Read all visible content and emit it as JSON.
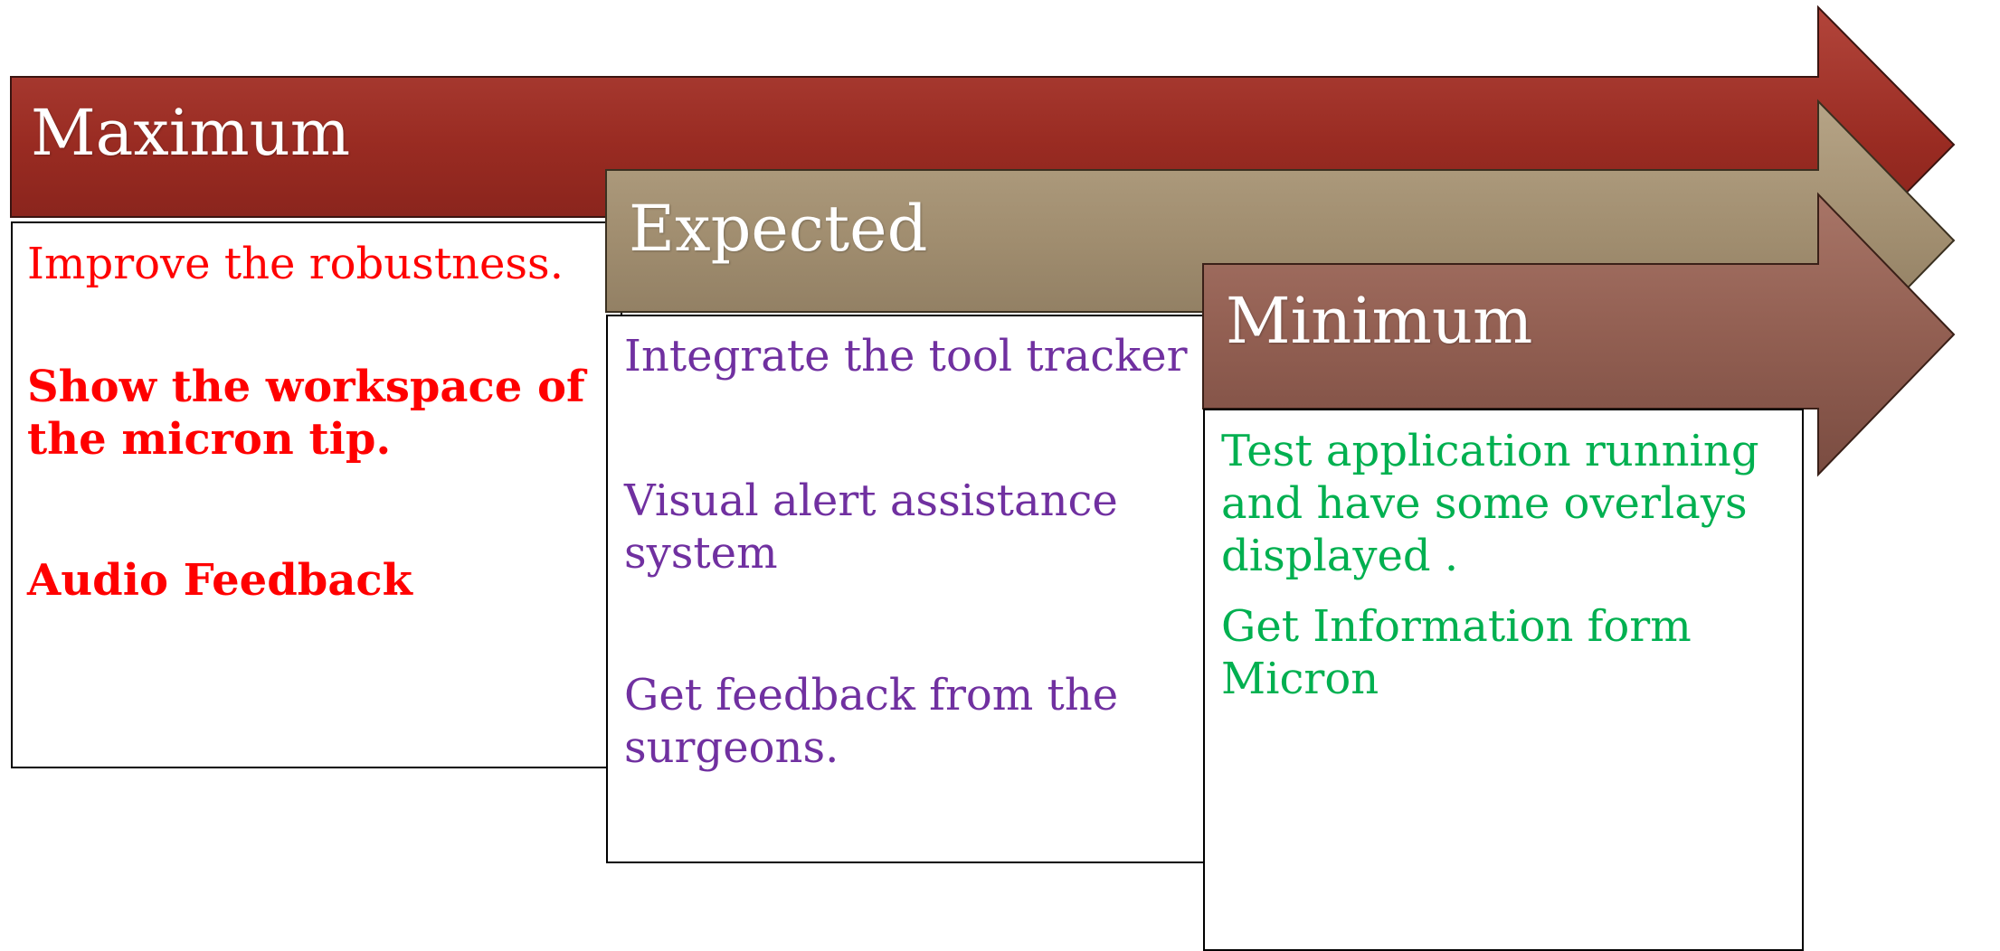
{
  "colors": {
    "maximum_arrow": "#992b22",
    "expected_arrow": "#a08d6f",
    "minimum_arrow": "#925f52",
    "maximum_text": "#ff0000",
    "expected_text": "#7030a0",
    "minimum_text": "#00b050"
  },
  "maximum": {
    "title": "Maximum",
    "items": [
      "Improve the robustness.",
      "Show the workspace of the micron tip.",
      "Audio Feedback"
    ]
  },
  "expected": {
    "title": "Expected",
    "items": [
      "Integrate the tool tracker",
      "Visual alert assistance system",
      "Get feedback from the surgeons."
    ]
  },
  "minimum": {
    "title": "Minimum",
    "items": [
      "Test application running and have some overlays displayed .",
      "Get Information form Micron"
    ]
  }
}
